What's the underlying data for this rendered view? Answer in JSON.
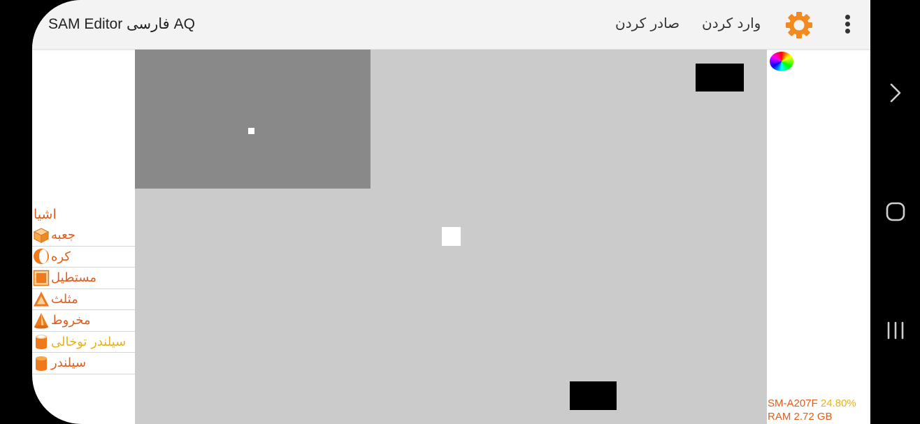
{
  "app": {
    "title": "SAM Editor فارسی AQ"
  },
  "toolbar": {
    "export_label": "صادر کردن",
    "import_label": "وارد کردن",
    "settings_icon": "gear-icon",
    "overflow_icon": "more-vert-icon"
  },
  "objects": {
    "title": "اشیا",
    "items": [
      {
        "label": "جعبه",
        "icon": "box-icon"
      },
      {
        "label": "کره",
        "icon": "sphere-icon"
      },
      {
        "label": "مستطیل",
        "icon": "rectangle-icon"
      },
      {
        "label": "مثلث",
        "icon": "triangle-icon"
      },
      {
        "label": "مخروط",
        "icon": "cone-icon"
      },
      {
        "label": "سیلندر توخالی",
        "icon": "hollow-cylinder-icon"
      },
      {
        "label": "سیلندر",
        "icon": "cylinder-icon"
      }
    ]
  },
  "status": {
    "model": "SM-A207F",
    "battery": "24.80%",
    "ram": "RAM 2.72 GB"
  },
  "colors": {
    "accent": "#e05d1d",
    "highlight": "#e8b21a",
    "gear": "#f28a1f",
    "canvas": "#cbcbcb",
    "viewport": "#898989"
  }
}
